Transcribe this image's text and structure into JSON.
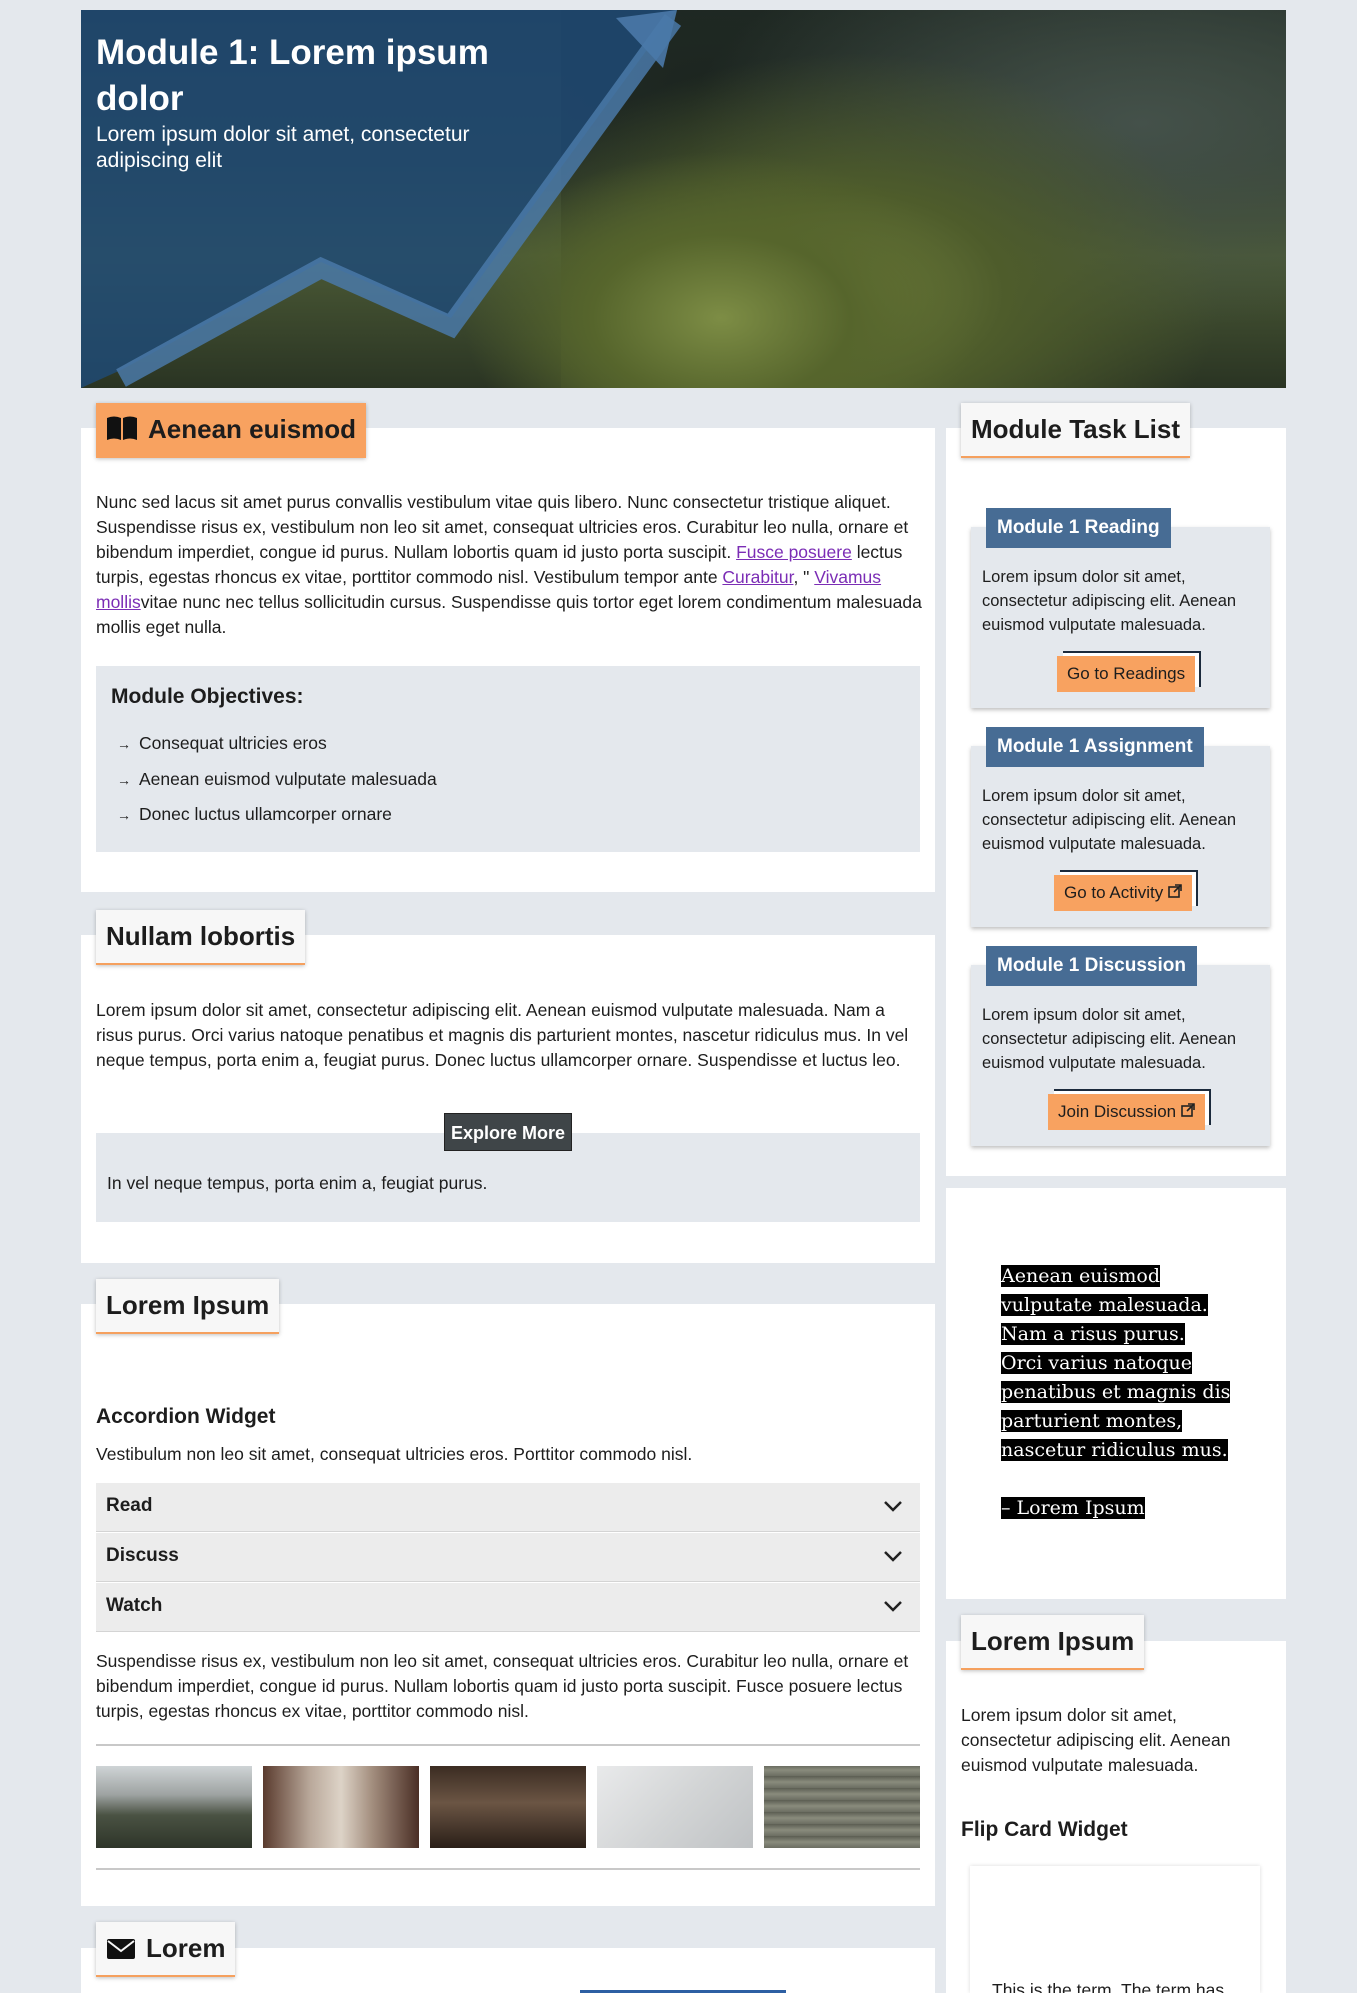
{
  "hero": {
    "title": "Module 1: Lorem ipsum dolor",
    "subtitle": "Lorem ipsum dolor sit amet, consectetur adipiscing elit"
  },
  "section1": {
    "tab": "Aenean euismod",
    "icon": "book-icon",
    "para_1": "Nunc sed lacus sit amet purus convallis vestibulum vitae quis libero. Nunc consectetur tristique aliquet. Suspendisse risus ex, vestibulum non leo sit amet, consequat ultricies eros. Curabitur leo nulla, ornare et bibendum imperdiet, congue id purus. Nullam lobortis quam id justo porta suscipit. ",
    "link_1": "Fusce posuere",
    "para_2": " lectus turpis, egestas rhoncus ex vitae, porttitor commodo nisl. Vestibulum tempor ante ",
    "link_2": "Curabitur",
    "para_3": ", \" ",
    "link_3": "Vivamus mollis",
    "para_4": "vitae nunc nec tellus sollicitudin cursus. Suspendisse quis tortor eget lorem condimentum malesuada mollis eget nulla.",
    "objectives_title": "Module Objectives:",
    "objectives": [
      "Consequat ultricies eros",
      "Aenean euismod vulputate malesuada",
      "Donec luctus ullamcorper ornare"
    ]
  },
  "section2": {
    "tab": "Nullam lobortis",
    "para": "Lorem ipsum dolor sit amet, consectetur adipiscing elit. Aenean euismod vulputate malesuada. Nam a risus purus. Orci varius natoque penatibus et magnis dis parturient montes, nascetur ridiculus mus. In vel neque tempus, porta enim a, feugiat purus. Donec luctus ullamcorper ornare. Suspendisse et luctus leo.",
    "button": "Explore More",
    "box_text": "In vel neque tempus, porta enim a, feugiat purus."
  },
  "section3": {
    "tab": "Lorem Ipsum",
    "widget_title": "Accordion Widget",
    "widget_desc": "Vestibulum non leo sit amet, consequat ultricies eros. Porttitor commodo nisl.",
    "accordion": [
      "Read",
      "Discuss",
      "Watch"
    ],
    "para": "Suspendisse risus ex, vestibulum non leo sit amet, consequat ultricies eros. Curabitur leo nulla, ornare et bibendum imperdiet, congue id purus. Nullam lobortis quam id justo porta suscipit. Fusce posuere lectus turpis, egestas rhoncus ex vitae, porttitor commodo nisl."
  },
  "section4": {
    "tab": "Lorem",
    "icon": "envelope-icon"
  },
  "sidebar": {
    "task_list_title": "Module Task List",
    "tasks": [
      {
        "tag": "Module 1 Reading",
        "text": "Lorem ipsum dolor sit amet, consectetur adipiscing elit. Aenean euismod vulputate malesuada.",
        "button": "Go to Readings"
      },
      {
        "tag": "Module 1 Assignment",
        "text": "Lorem ipsum dolor sit amet, consectetur adipiscing elit. Aenean euismod vulputate malesuada.",
        "button": "Go to Activity"
      },
      {
        "tag": "Module 1 Discussion",
        "text": "Lorem ipsum dolor sit amet, consectetur adipiscing elit. Aenean euismod vulputate malesuada.",
        "button": "Join Discussion"
      }
    ],
    "quote_lines": [
      "Aenean euismod",
      "vulputate malesuada.",
      "Nam a risus purus.",
      "Orci varius natoque",
      "penatibus et magnis dis",
      "parturient montes,",
      "nascetur ridiculus mus."
    ],
    "quote_author": "– Lorem Ipsum",
    "card2_tab": "Lorem Ipsum",
    "card2_text": "Lorem ipsum dolor sit amet, consectetur adipiscing elit. Aenean euismod vulputate malesuada.",
    "card2_widget": "Flip Card Widget",
    "flip_text": "This is the term. The term has"
  },
  "colors": {
    "accent_orange": "#f8a260",
    "tag_blue": "#476c94",
    "hero_blue": "#1f4a78",
    "link_purple": "#7b2db5"
  }
}
